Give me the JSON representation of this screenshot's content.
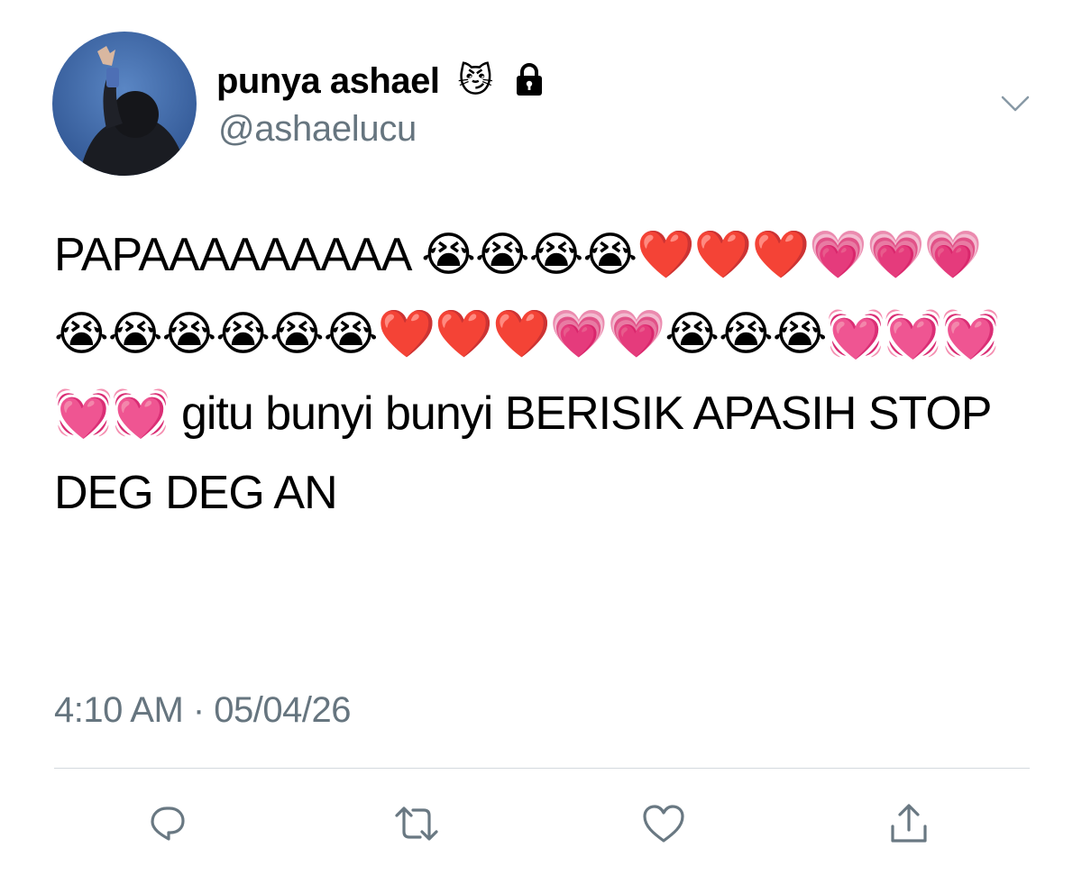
{
  "user": {
    "display_name": "punya ashael",
    "badge_emoji": "😼",
    "handle": "@ashaelucu",
    "avatar": "profile-photo",
    "lock_icon": "lock-icon"
  },
  "tweet": {
    "text": "PAPAAAAAAAAA 😭😭😭😭❤️❤️❤️💗💗💗😭😭😭😭😭😭❤️❤️❤️💗💗😭😭😭💓💓💓💓💓 gitu bunyi bunyi BERISIK APASIH STOP DEG DEG AN",
    "timestamp": "4:10 AM · 05/04/26"
  },
  "actions": {
    "reply": "reply-icon",
    "retweet": "retweet-icon",
    "like": "heart-icon",
    "share": "share-icon"
  },
  "colors": {
    "text": "#000000",
    "secondary": "#66757f",
    "icon": "#697882",
    "divider": "#d4d9de"
  }
}
